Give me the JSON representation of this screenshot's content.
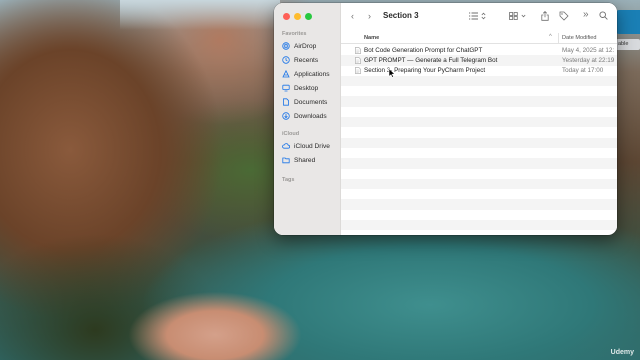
{
  "window": {
    "title": "Section 3",
    "traffic_lights": [
      "close",
      "minimize",
      "zoom"
    ]
  },
  "sidebar": {
    "favorites_header": "Favorites",
    "favorites": [
      {
        "label": "AirDrop",
        "icon": "airdrop-icon"
      },
      {
        "label": "Recents",
        "icon": "clock-icon"
      },
      {
        "label": "Applications",
        "icon": "applications-icon"
      },
      {
        "label": "Desktop",
        "icon": "desktop-icon"
      },
      {
        "label": "Documents",
        "icon": "document-icon"
      },
      {
        "label": "Downloads",
        "icon": "download-icon"
      }
    ],
    "icloud_header": "iCloud",
    "icloud": [
      {
        "label": "iCloud Drive",
        "icon": "cloud-icon"
      },
      {
        "label": "Shared",
        "icon": "shared-folder-icon"
      }
    ],
    "tags_header": "Tags"
  },
  "toolbar": {
    "back": "‹",
    "forward": "›",
    "list_view_icon": "list-view-icon",
    "grid_view_icon": "grid-view-icon",
    "share_icon": "share-icon",
    "tag_icon": "tag-icon",
    "more": "»",
    "search_icon": "search-icon"
  },
  "columns": {
    "name": "Name",
    "date_modified": "Date Modified",
    "sort_indicator": "^"
  },
  "files": [
    {
      "name": "Bot Code Generation Prompt for ChatGPT",
      "date": "May 4, 2025 at 12:"
    },
    {
      "name": "GPT PROMPT — Generate a Full Telegram Bot",
      "date": "Yesterday at 22:19"
    },
    {
      "name": "Section 3- Preparing Your PyCharm Project",
      "date": "Today at 17:00"
    }
  ],
  "desktop": {
    "edge_label": "able",
    "watermark": "Udemy"
  },
  "colors": {
    "accent": "#1a74e8",
    "close": "#fe5f57",
    "minimize": "#febc2e",
    "zoom": "#28c840"
  }
}
